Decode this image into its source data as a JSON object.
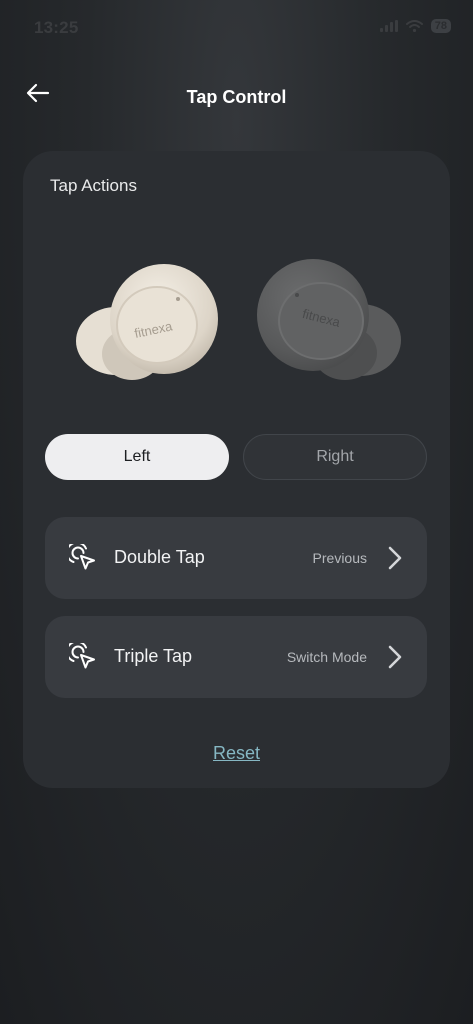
{
  "status_bar": {
    "time": "13:25",
    "battery": "78"
  },
  "header": {
    "title": "Tap Control"
  },
  "card": {
    "title": "Tap Actions",
    "earbuds": {
      "brand": "fitnexa"
    },
    "segments": {
      "left": "Left",
      "right": "Right",
      "selected": "Left"
    },
    "actions": [
      {
        "label": "Double Tap",
        "value": "Previous",
        "icon": "tap-gesture-icon"
      },
      {
        "label": "Triple Tap",
        "value": "Switch Mode",
        "icon": "tap-gesture-icon"
      }
    ],
    "reset_label": "Reset"
  },
  "colors": {
    "accent_link": "#86b7c3",
    "card_bg": "#2b2e32",
    "row_bg": "#383b40"
  }
}
